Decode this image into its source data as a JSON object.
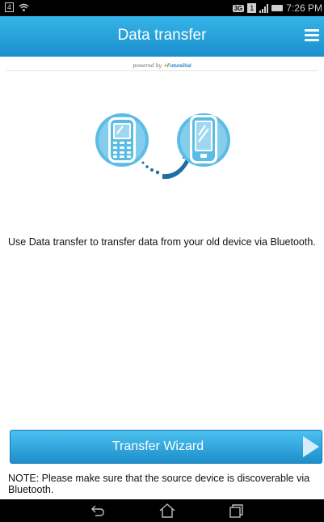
{
  "status_bar": {
    "notification_badge": "4",
    "network_type": "3G",
    "sim_badge": "1",
    "time": "7:26 PM"
  },
  "app_bar": {
    "title": "Data transfer",
    "menu_icon": "hamburger-menu-icon"
  },
  "powered_by": {
    "prefix": "powered by",
    "brand": "FutureDial"
  },
  "illustration": {
    "source_device_icon": "old-phone-icon",
    "arrow_icon": "transfer-arrow-icon",
    "target_device_icon": "smartphone-icon",
    "accent_color": "#5bbce6"
  },
  "description": "Use Data transfer to transfer data from your old device via Bluetooth.",
  "wizard_button": {
    "label": "Transfer Wizard",
    "icon": "play-arrow-icon"
  },
  "note": "NOTE: Please make sure that the source device is discoverable via Bluetooth.",
  "nav_bar": {
    "back_icon": "back-icon",
    "home_icon": "home-icon",
    "recents_icon": "recent-apps-icon"
  },
  "colors": {
    "app_bar": "#1f98d5",
    "button": "#2aa3dc"
  }
}
